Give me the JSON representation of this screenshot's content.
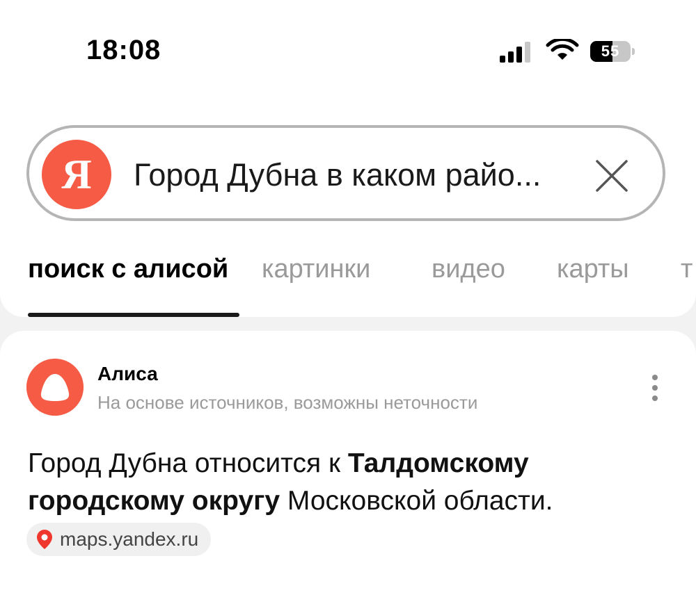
{
  "status_bar": {
    "time": "18:08",
    "battery_percent": "55",
    "battery_level": 0.55
  },
  "search": {
    "logo_letter": "Я",
    "query": "Город Дубна в каком райо..."
  },
  "tabs": [
    {
      "label": "поиск с алисой",
      "active": true
    },
    {
      "label": "картинки",
      "active": false
    },
    {
      "label": "видео",
      "active": false
    },
    {
      "label": "карты",
      "active": false
    },
    {
      "label": "т",
      "active": false
    }
  ],
  "answer_card": {
    "assistant_name": "Алиса",
    "disclaimer": "На основе источников, возможны неточности",
    "answer_part1": "Город Дубна относится к ",
    "answer_bold": "Талдомскому городскому округу",
    "answer_part2": " Московской области.",
    "source_label": "maps.yandex.ru",
    "icons": [
      "alice-logo-icon",
      "more-vertical-icon",
      "map-pin-icon"
    ]
  },
  "colors": {
    "brand_red": "#f55b45",
    "pin_red": "#f0372e"
  }
}
